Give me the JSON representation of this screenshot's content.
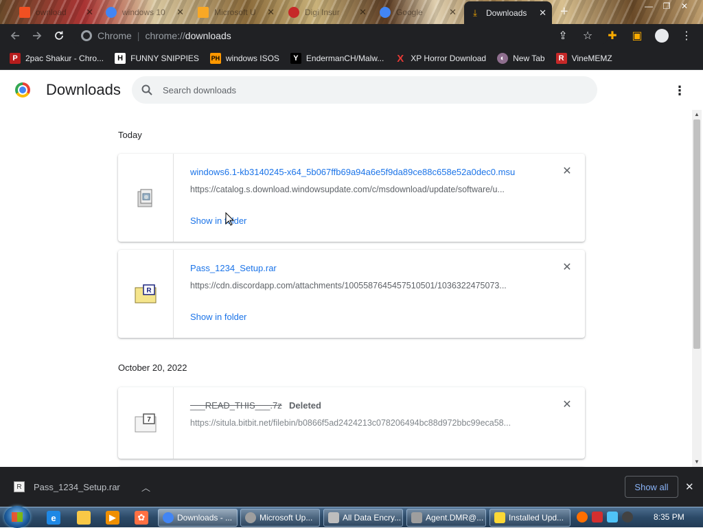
{
  "tabs": [
    {
      "label": "ownload",
      "favicon_color": "#f25022"
    },
    {
      "label": "windows 10",
      "favicon_color": "#4285f4"
    },
    {
      "label": "Microsoft U",
      "favicon_color": "#f9a825"
    },
    {
      "label": "Digi  Insur",
      "favicon_color": "#c62828"
    },
    {
      "label": "Google",
      "favicon_color": "#4285f4"
    },
    {
      "label": "Downloads",
      "favicon_color": "#f9ab00"
    }
  ],
  "new_tab_symbol": "+",
  "omnibox": {
    "scheme_label": "Chrome",
    "url_prefix": "chrome://",
    "url_host": "downloads"
  },
  "bookmarks": [
    {
      "label": "2pac Shakur - Chro...",
      "icon": "P",
      "color": "#b71c1c"
    },
    {
      "label": "FUNNY SNIPPIES",
      "icon": "H",
      "color": "#212121"
    },
    {
      "label": "windows ISOS",
      "icon": "PH",
      "color": "#ff9800"
    },
    {
      "label": "EndermanCH/Malw...",
      "icon": "Y",
      "color": "#212121"
    },
    {
      "label": "XP Horror Download",
      "icon": "X",
      "color": "#e53935"
    },
    {
      "label": "New Tab",
      "icon": "◐",
      "color": "#8e6e8e"
    },
    {
      "label": "VineMEMZ",
      "icon": "R",
      "color": "#c62828"
    }
  ],
  "page": {
    "title": "Downloads",
    "search_placeholder": "Search downloads"
  },
  "groups": [
    {
      "date": "Today",
      "items": [
        {
          "filename": "windows6.1-kb3140245-x64_5b067ffb69a94a6e5f9da89ce88c658e52a0dec0.msu",
          "url": "https://catalog.s.download.windowsupdate.com/c/msdownload/update/software/u...",
          "action": "Show in folder",
          "status": ""
        },
        {
          "filename": "Pass_1234_Setup.rar",
          "url": "https://cdn.discordapp.com/attachments/1005587645457510501/1036322475073...",
          "action": "Show in folder",
          "status": ""
        }
      ]
    },
    {
      "date": "October 20, 2022",
      "items": [
        {
          "filename": "___READ_THIS___.7z",
          "url": "https://situla.bitbit.net/filebin/b0866f5ad2424213c078206494bc88d972bbc99eca58...",
          "action": "",
          "status": "Deleted"
        }
      ]
    }
  ],
  "shelf": {
    "filename": "Pass_1234_Setup.rar",
    "show_all_label": "Show all"
  },
  "taskbar": {
    "buttons": [
      {
        "label": "Downloads - ...",
        "color": "#4285f4"
      },
      {
        "label": "Microsoft Up...",
        "color": "#9e9e9e"
      },
      {
        "label": "All Data Encry...",
        "color": "#bdbdbd"
      },
      {
        "label": "Agent.DMR@...",
        "color": "#9e9e9e"
      },
      {
        "label": "Installed Upd...",
        "color": "#fdd835"
      }
    ],
    "time": "8:35 PM"
  }
}
